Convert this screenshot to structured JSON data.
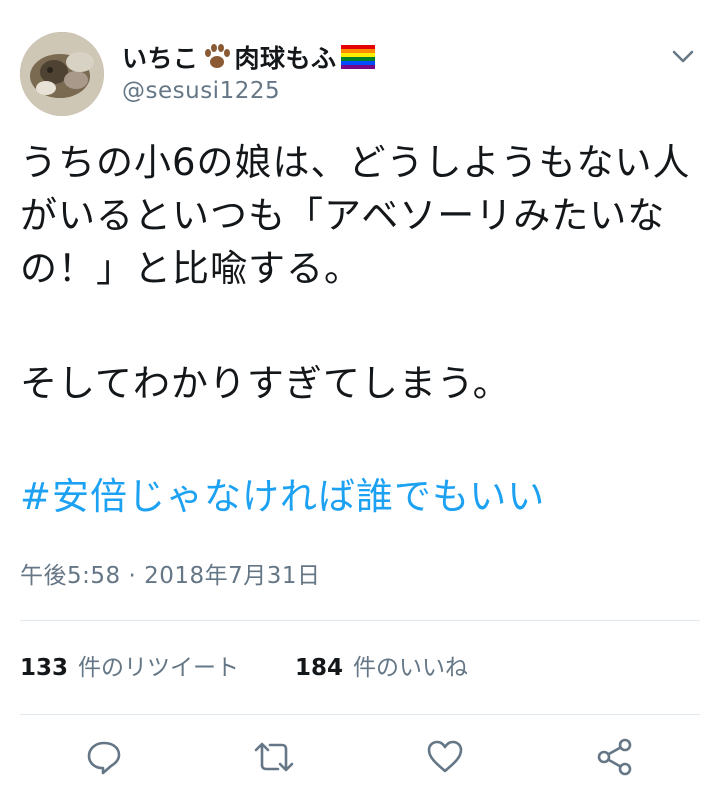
{
  "user": {
    "display_name": "いちこ",
    "display_name_suffix": "肉球もふ",
    "handle": "@sesusi1225"
  },
  "tweet": {
    "text_para1": "うちの小6の娘は、どうしようもない人がいるといつも「アベソーリみたいなの！」と比喩する。",
    "text_para2": "そしてわかりすぎてしまう。",
    "hashtag": "#安倍じゃなければ誰でもいい",
    "timestamp": "午後5:58 · 2018年7月31日"
  },
  "stats": {
    "retweets_count": "133",
    "retweets_label": "件のリツイート",
    "likes_count": "184",
    "likes_label": "件のいいね"
  },
  "icons": {
    "menu": "chevron-down-icon",
    "reply": "reply-icon",
    "retweet": "retweet-icon",
    "like": "heart-icon",
    "share": "share-icon",
    "name_emoji_1": "paw-icon",
    "name_emoji_2": "rainbow-flag-icon"
  },
  "colors": {
    "text": "#14171a",
    "secondary": "#657786",
    "link": "#1da1f2",
    "divider": "#e1e8ed"
  }
}
